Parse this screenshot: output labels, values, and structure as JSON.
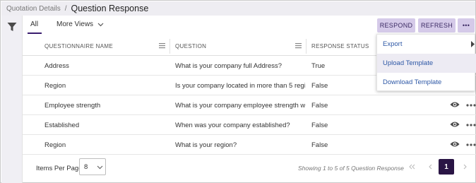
{
  "breadcrumb": {
    "parent": "Quotation Details",
    "separator": "/",
    "current": "Question Response"
  },
  "tabs": {
    "all": "All",
    "more_views": "More Views"
  },
  "actions": {
    "respond": "RESPOND",
    "refresh": "REFRESH",
    "more": "•••"
  },
  "menu": {
    "export": "Export",
    "upload": "Upload Template",
    "download": "Download Template"
  },
  "table": {
    "headers": [
      "QUESTIONNAIRE NAME",
      "QUESTION",
      "RESPONSE STATUS"
    ],
    "rows": [
      {
        "name": "Address",
        "question": "What is your company full Address?",
        "status": "True"
      },
      {
        "name": "Region",
        "question": "Is your company located in more than 5 regi...",
        "status": "False"
      },
      {
        "name": "Employee strength",
        "question": "What is your company employee strength w...",
        "status": "False"
      },
      {
        "name": "Established",
        "question": "When was your company established?",
        "status": "False"
      },
      {
        "name": "Region",
        "question": "What is your region?",
        "status": "False"
      }
    ]
  },
  "footer": {
    "items_per_page_label": "Items Per Page",
    "items_per_page_value": "8",
    "showing": "Showing 1 to 5 of 5 Question Response",
    "current_page": "1"
  },
  "colors": {
    "accent": "#2a1545",
    "button_bg": "#d5cae9",
    "link": "#2e58a6",
    "header_bg": "#eeedf2"
  },
  "icons": [
    "filter-icon",
    "chevron-down-icon",
    "column-menu-icon",
    "view-eye-icon",
    "more-options-icon",
    "first-page-icon",
    "prev-page-icon",
    "next-page-icon",
    "submenu-arrow-icon"
  ]
}
